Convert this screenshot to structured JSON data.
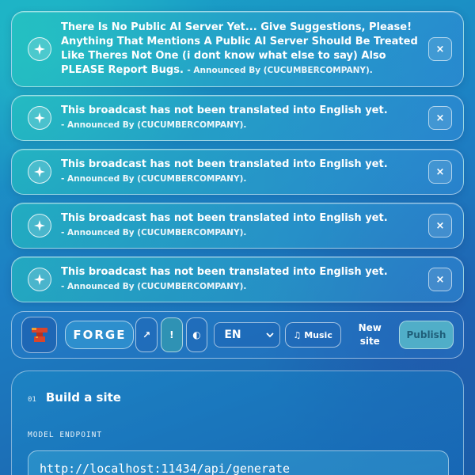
{
  "toasts": [
    {
      "message": "There Is No Public AI Server Yet... Give Suggestions, Please! Anything That Mentions A Public AI Server Should Be Treated Like Theres Not One (i dont know what else to say) Also PLEASE Report Bugs.",
      "author": "- Announced By (CUCUMBERCOMPANY).",
      "icon": "sparkle-icon",
      "close": "×"
    },
    {
      "message": "This broadcast has not been translated into English yet.",
      "author": "- Announced By (CUCUMBERCOMPANY).",
      "icon": "sparkle-icon",
      "close": "×"
    },
    {
      "message": "This broadcast has not been translated into English yet.",
      "author": "- Announced By (CUCUMBERCOMPANY).",
      "icon": "sparkle-icon",
      "close": "×"
    },
    {
      "message": "This broadcast has not been translated into English yet.",
      "author": "- Announced By (CUCUMBERCOMPANY).",
      "icon": "sparkle-icon",
      "close": "×"
    },
    {
      "message": "This broadcast has not been translated into English yet.",
      "author": "- Announced By (CUCUMBERCOMPANY).",
      "icon": "sparkle-icon",
      "close": "×"
    }
  ],
  "toolbar": {
    "brand": "FORGE",
    "open_icon": "↗",
    "alert_icon": "!",
    "theme_icon": "◐",
    "language": "EN",
    "music_label": "Music",
    "music_icon": "♫",
    "new_site_line1": "New",
    "new_site_line2": "site",
    "publish_label": "Publish"
  },
  "panel": {
    "step_number": "01",
    "step_title": "Build a site",
    "endpoint_label": "MODEL ENDPOINT",
    "endpoint_value": "http://localhost:11434/api/generate"
  },
  "colors": {
    "background_top": "#18a7c6",
    "background_bottom": "#1a5ea8",
    "logo_red": "#d9452b",
    "logo_orange": "#f0a030",
    "publish_text": "#1f5f7a"
  }
}
